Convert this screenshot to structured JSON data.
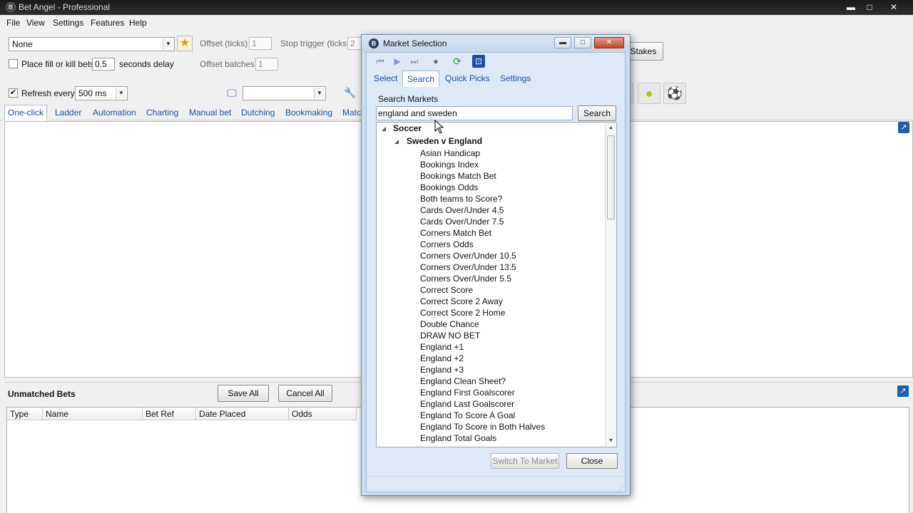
{
  "window": {
    "title": "Bet Angel - Professional",
    "min": "▬",
    "max": "□",
    "close": "✕"
  },
  "menu": [
    "File",
    "View",
    "Settings",
    "Features",
    "Help"
  ],
  "toolbar": {
    "profile_select": "None",
    "offset_ticks_label": "Offset (ticks)",
    "offset_ticks_value": "1",
    "stop_trigger_label": "Stop trigger (ticks)",
    "stop_trigger_value": "2",
    "fill_kill_label": "Place fill or kill bets",
    "fill_kill_value": "0.5",
    "seconds_delay_label": "seconds delay",
    "offset_batches_label": "Offset batches",
    "offset_batches_value": "1",
    "refresh_label": "Refresh every",
    "refresh_value": "500 ms",
    "stakes_label": "Stakes",
    "extra_select": ""
  },
  "tabs": [
    "One-click",
    "Ladder",
    "Automation",
    "Charting",
    "Manual bet",
    "Dutching",
    "Bookmaking",
    "Matc"
  ],
  "unmatched": {
    "title": "Unmatched Bets",
    "save_all": "Save All",
    "cancel_all": "Cancel All",
    "columns": [
      "Type",
      "Name",
      "Bet Ref",
      "Date Placed",
      "Odds"
    ]
  },
  "dialog": {
    "title": "Market Selection",
    "tabs": [
      "Select",
      "Search",
      "Quick Picks",
      "Settings"
    ],
    "search_label": "Search Markets",
    "search_value": "england and sweden",
    "search_button": "Search",
    "tree": {
      "sport": "Soccer",
      "event": "Sweden v England",
      "markets": [
        "Asian Handicap",
        "Bookings Index",
        "Bookings Match Bet",
        "Bookings Odds",
        "Both teams to Score?",
        "Cards Over/Under 4.5",
        "Cards Over/Under 7.5",
        "Corners Match Bet",
        "Corners Odds",
        "Corners Over/Under 10.5",
        "Corners Over/Under 13.5",
        "Corners Over/Under 5.5",
        "Correct Score",
        "Correct Score 2 Away",
        "Correct Score 2 Home",
        "Double Chance",
        "DRAW NO BET",
        "England +1",
        "England +2",
        "England +3",
        "England Clean Sheet?",
        "England First Goalscorer",
        "England Last Goalscorer",
        "England To Score A Goal",
        "England To Score in Both Halves",
        "England Total Goals"
      ]
    },
    "switch_button": "Switch To Market",
    "close_button": "Close"
  }
}
